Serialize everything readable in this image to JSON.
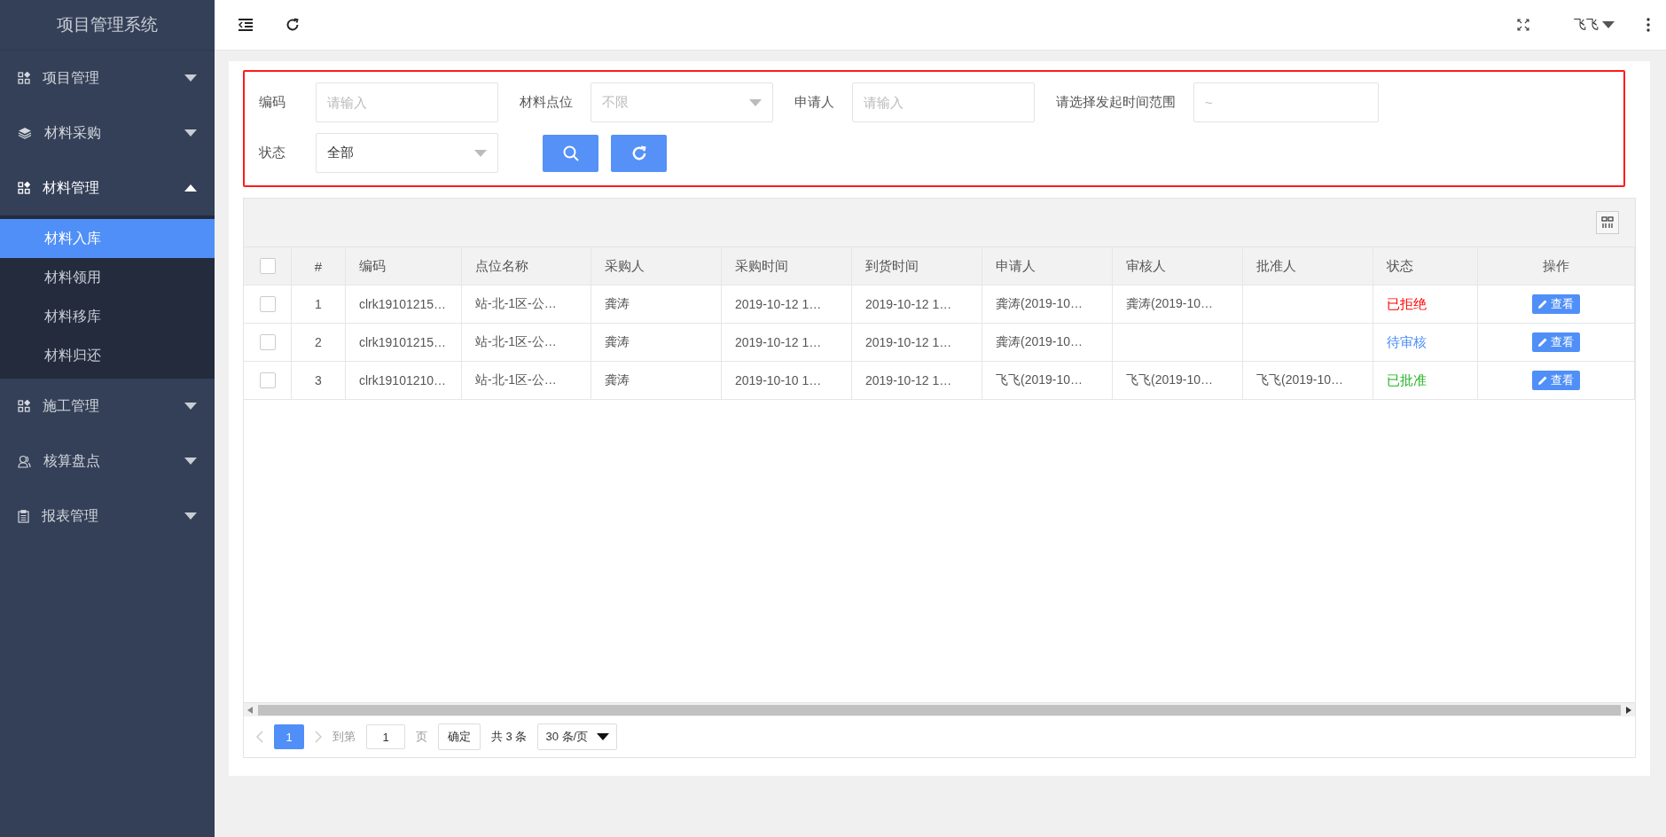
{
  "sidebar": {
    "title": "项目管理系统",
    "items": [
      {
        "label": "项目管理",
        "expanded": false
      },
      {
        "label": "材料采购",
        "expanded": false
      },
      {
        "label": "材料管理",
        "expanded": true,
        "children": [
          {
            "label": "材料入库",
            "selected": true
          },
          {
            "label": "材料领用",
            "selected": false
          },
          {
            "label": "材料移库",
            "selected": false
          },
          {
            "label": "材料归还",
            "selected": false
          }
        ]
      },
      {
        "label": "施工管理",
        "expanded": false
      },
      {
        "label": "核算盘点",
        "expanded": false
      },
      {
        "label": "报表管理",
        "expanded": false
      }
    ]
  },
  "topbar": {
    "user": "飞飞"
  },
  "filters": [
    {
      "label": "编码",
      "kind": "input",
      "placeholder": "请输入"
    },
    {
      "label": "材料点位",
      "kind": "select",
      "placeholder": "不限"
    },
    {
      "label": "申请人",
      "kind": "input",
      "placeholder": "请输入"
    },
    {
      "label": "请选择发起时间范围",
      "kind": "range",
      "placeholder": "~"
    },
    {
      "label": "状态",
      "kind": "select",
      "value": "全部"
    }
  ],
  "table": {
    "all_checked": false,
    "columns": [
      "#",
      "编码",
      "点位名称",
      "采购人",
      "采购时间",
      "到货时间",
      "申请人",
      "审核人",
      "批准人",
      "状态",
      "操作"
    ],
    "rows": [
      {
        "checked": false,
        "cells": [
          "1",
          "clrk19101215…",
          "站-北-1区-公…",
          "龚涛",
          "2019-10-12 1…",
          "2019-10-12 1…",
          "龚涛(2019-10…",
          "龚涛(2019-10…",
          ""
        ],
        "status": "已拒绝",
        "color": "#ff0000",
        "action": "查看"
      },
      {
        "checked": false,
        "cells": [
          "2",
          "clrk19101215…",
          "站-北-1区-公…",
          "龚涛",
          "2019-10-12 1…",
          "2019-10-12 1…",
          "龚涛(2019-10…",
          "",
          ""
        ],
        "status": "待审核",
        "color": "#4a8cf7",
        "action": "查看"
      },
      {
        "checked": false,
        "cells": [
          "3",
          "clrk19101210…",
          "站-北-1区-公…",
          "龚涛",
          "2019-10-10 1…",
          "2019-10-12 1…",
          "飞飞(2019-10…",
          "飞飞(2019-10…",
          "飞飞(2019-10…"
        ],
        "status": "已批准",
        "color": "#22b322",
        "action": "查看"
      }
    ]
  },
  "pagination": {
    "page": "1",
    "goto_label": "到第",
    "goto_value": "1",
    "page_unit": "页",
    "confirm": "确定",
    "total": "共 3 条",
    "page_size": "30 条/页"
  }
}
